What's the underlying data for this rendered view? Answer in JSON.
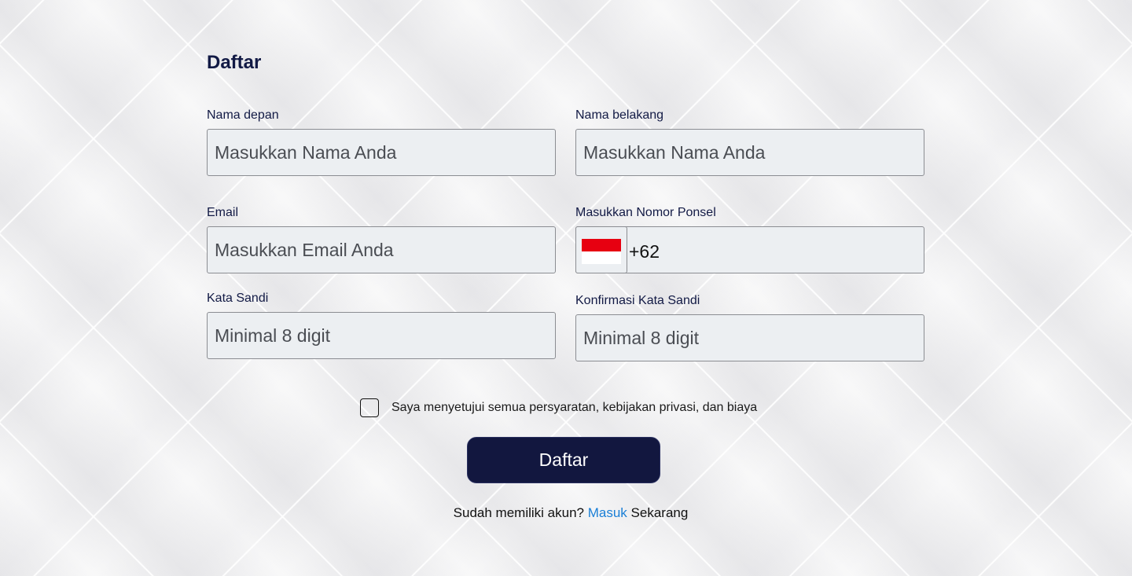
{
  "page": {
    "title": "Daftar"
  },
  "form": {
    "first_name": {
      "label": "Nama depan",
      "placeholder": "Masukkan Nama Anda"
    },
    "last_name": {
      "label": "Nama belakang",
      "placeholder": "Masukkan Nama Anda"
    },
    "email": {
      "label": "Email",
      "placeholder": "Masukkan Email Anda"
    },
    "phone": {
      "label": "Masukkan Nomor Ponsel",
      "country_code": "+62",
      "flag_icon": "indonesia-flag-icon",
      "flag_colors": [
        "#e70011",
        "#ffffff"
      ]
    },
    "password": {
      "label": "Kata Sandi",
      "placeholder": "Minimal 8 digit"
    },
    "confirm_password": {
      "label": "Konfirmasi Kata Sandi",
      "placeholder": "Minimal 8 digit"
    },
    "agreement": {
      "text": "Saya menyetujui semua persyaratan, kebijakan privasi, dan biaya",
      "checked": false
    },
    "submit_label": "Daftar"
  },
  "footer": {
    "prefix": "Sudah memiliki akun?",
    "link": "Masuk",
    "suffix": "Sekarang"
  },
  "colors": {
    "primary": "#12173f",
    "link": "#1a7fd6",
    "input_bg": "#eceff2"
  }
}
